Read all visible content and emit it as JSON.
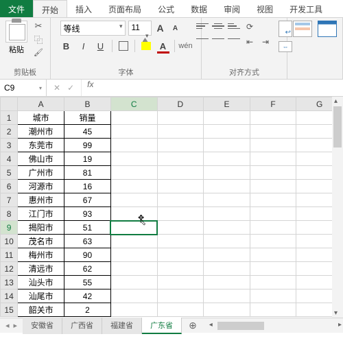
{
  "tabs": {
    "file": "文件",
    "items": [
      "开始",
      "插入",
      "页面布局",
      "公式",
      "数据",
      "审阅",
      "视图",
      "开发工具"
    ],
    "active": 0
  },
  "ribbon": {
    "clipboard": {
      "paste": "粘贴",
      "label": "剪贴板"
    },
    "font": {
      "name": "等线",
      "size": "11",
      "label": "字体",
      "wen": "wén"
    },
    "align": {
      "label": "对齐方式"
    }
  },
  "namebox": "C9",
  "columns": [
    "A",
    "B",
    "C",
    "D",
    "E",
    "F",
    "G"
  ],
  "header": {
    "city": "城市",
    "sales": "销量"
  },
  "rows": [
    {
      "n": 1
    },
    {
      "n": 2,
      "city": "潮州市",
      "sales": "45"
    },
    {
      "n": 3,
      "city": "东莞市",
      "sales": "99"
    },
    {
      "n": 4,
      "city": "佛山市",
      "sales": "19"
    },
    {
      "n": 5,
      "city": "广州市",
      "sales": "81"
    },
    {
      "n": 6,
      "city": "河源市",
      "sales": "16"
    },
    {
      "n": 7,
      "city": "惠州市",
      "sales": "67"
    },
    {
      "n": 8,
      "city": "江门市",
      "sales": "93"
    },
    {
      "n": 9,
      "city": "揭阳市",
      "sales": "51"
    },
    {
      "n": 10,
      "city": "茂名市",
      "sales": "63"
    },
    {
      "n": 11,
      "city": "梅州市",
      "sales": "90"
    },
    {
      "n": 12,
      "city": "清远市",
      "sales": "62"
    },
    {
      "n": 13,
      "city": "汕头市",
      "sales": "55"
    },
    {
      "n": 14,
      "city": "汕尾市",
      "sales": "42"
    },
    {
      "n": 15,
      "city": "韶关市",
      "sales": "2"
    }
  ],
  "selected": {
    "row": 9,
    "col": "C"
  },
  "sheets": {
    "items": [
      "安徽省",
      "广西省",
      "福建省",
      "广东省"
    ],
    "active": 3
  }
}
